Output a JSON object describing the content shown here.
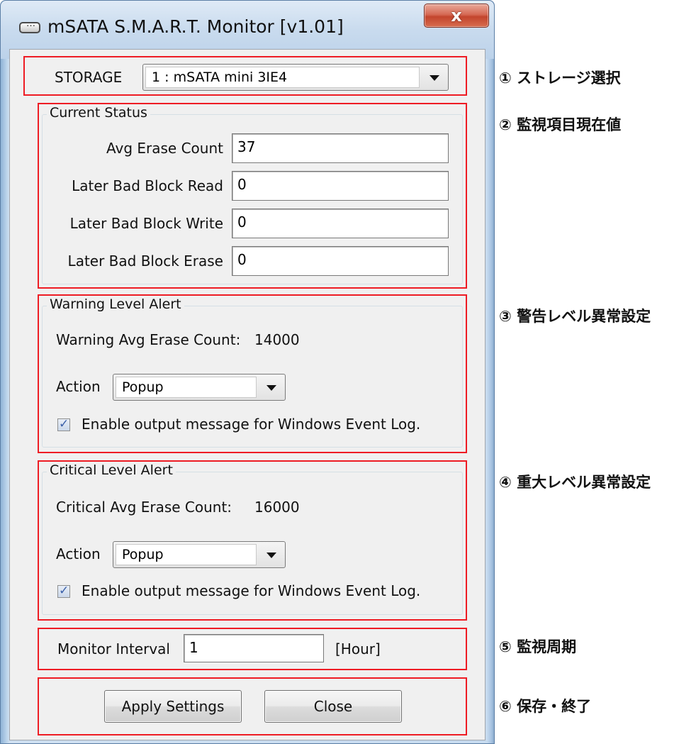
{
  "window": {
    "title": "mSATA S.M.A.R.T. Monitor [v1.01]",
    "close_glyph": "x"
  },
  "storage": {
    "label": "STORAGE",
    "selected": "1 : mSATA mini 3IE4"
  },
  "current_status": {
    "legend": "Current Status",
    "fields": [
      {
        "label": "Avg Erase Count",
        "value": "37"
      },
      {
        "label": "Later Bad Block Read",
        "value": "0"
      },
      {
        "label": "Later Bad Block Write",
        "value": "0"
      },
      {
        "label": "Later Bad Block Erase",
        "value": "0"
      }
    ]
  },
  "warning": {
    "legend": "Warning Level Alert",
    "count_label": "Warning Avg Erase Count:",
    "count_value": "14000",
    "action_label": "Action",
    "action_value": "Popup",
    "checkbox_label": "Enable output message for Windows Event Log.",
    "checkbox_checked": true
  },
  "critical": {
    "legend": "Critical Level Alert",
    "count_label": "Critical Avg Erase Count:",
    "count_value": "16000",
    "action_label": "Action",
    "action_value": "Popup",
    "checkbox_label": "Enable output message for Windows Event Log.",
    "checkbox_checked": true
  },
  "interval": {
    "label": "Monitor Interval",
    "value": "1",
    "unit": "[Hour]"
  },
  "buttons": {
    "apply": "Apply Settings",
    "close": "Close"
  },
  "annotations": [
    "① ストレージ選択",
    "② 監視項目現在値",
    "③ 警告レベル異常設定",
    "④ 重大レベル異常設定",
    "⑤ 監視周期",
    "⑥ 保存・終了"
  ],
  "colors": {
    "highlight_box": "#ee1c24",
    "window_frame": "#c7dbef",
    "close_button": "#c3452d",
    "client_bg": "#f0f0f0"
  }
}
